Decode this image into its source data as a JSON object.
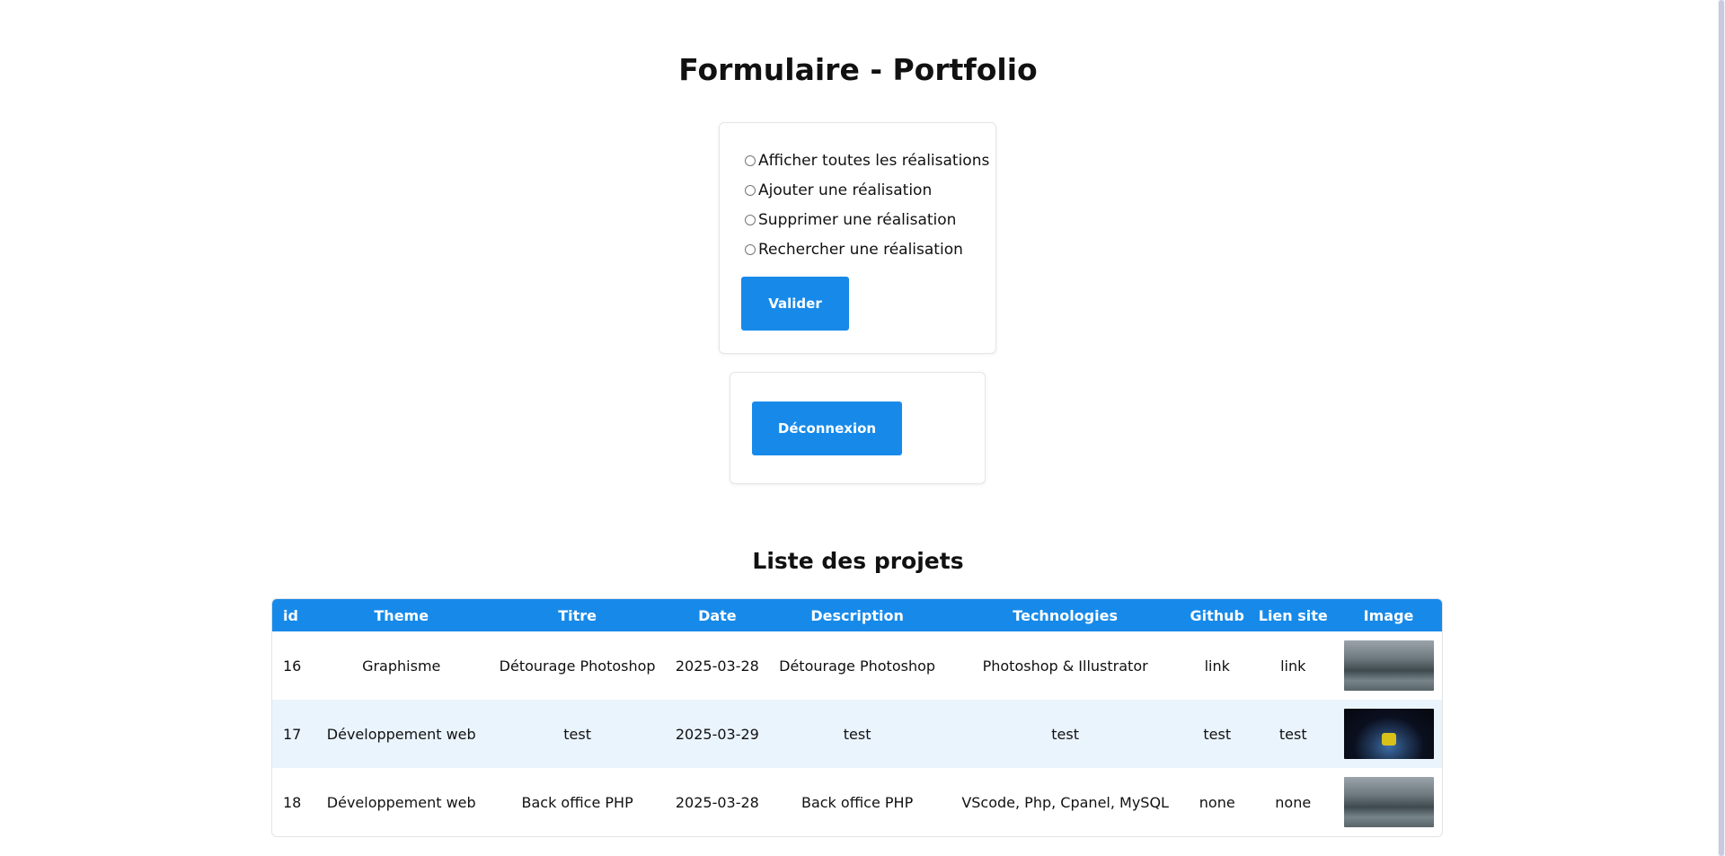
{
  "header": {
    "title": "Formulaire - Portfolio"
  },
  "form": {
    "options": [
      {
        "label": "Afficher toutes les réalisations",
        "checked": false
      },
      {
        "label": "Ajouter une réalisation",
        "checked": false
      },
      {
        "label": "Supprimer une réalisation",
        "checked": false
      },
      {
        "label": "Rechercher une réalisation",
        "checked": false
      }
    ],
    "submit_label": "Valider"
  },
  "logout": {
    "label": "Déconnexion"
  },
  "projects": {
    "title": "Liste des projets",
    "columns": [
      "id",
      "Theme",
      "Titre",
      "Date",
      "Description",
      "Technologies",
      "Github",
      "Lien site",
      "Image"
    ],
    "rows": [
      {
        "id": "16",
        "theme": "Graphisme",
        "titre": "Détourage Photoshop",
        "date": "2025-03-28",
        "description": "Détourage Photoshop",
        "technologies": "Photoshop & Illustrator",
        "github": "link",
        "lien_site": "link",
        "image": "cliff-landscape-thumbnail"
      },
      {
        "id": "17",
        "theme": "Développement web",
        "titre": "test",
        "date": "2025-03-29",
        "description": "test",
        "technologies": "test",
        "github": "test",
        "lien_site": "test",
        "image": "earth-space-thumbnail"
      },
      {
        "id": "18",
        "theme": "Développement web",
        "titre": "Back office PHP",
        "date": "2025-03-28",
        "description": "Back office PHP",
        "technologies": "VScode, Php, Cpanel, MySQL",
        "github": "none",
        "lien_site": "none",
        "image": "cliff-landscape-thumbnail"
      }
    ]
  },
  "colors": {
    "accent": "#178ae9",
    "row_alt": "#eaf4fd",
    "text": "#111111"
  }
}
